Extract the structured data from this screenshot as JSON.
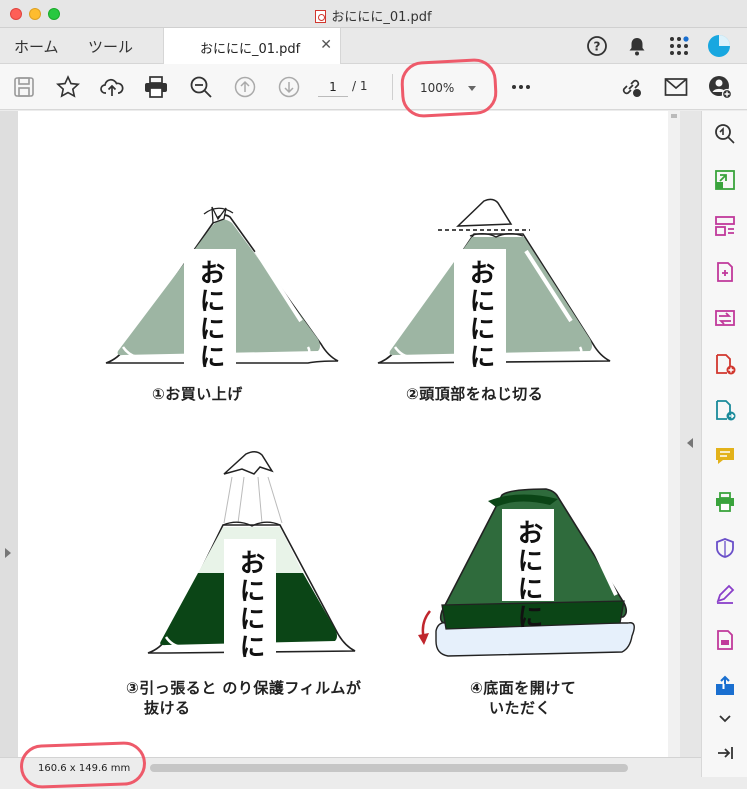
{
  "window": {
    "title": "おににに_01.pdf"
  },
  "tabs": {
    "home": "ホーム",
    "tools": "ツール",
    "document": "おににに_01.pdf"
  },
  "toolbar": {
    "page_current": "1",
    "page_total": "/ 1",
    "zoom": "100%"
  },
  "document": {
    "onigiri_label": "おににに",
    "steps": [
      {
        "caption": "①お買い上げ"
      },
      {
        "caption": "②頭頂部をねじ切る"
      },
      {
        "caption_line1": "③引っ張ると のり保護フィルムが",
        "caption_line2": "抜ける"
      },
      {
        "caption_line1": "④底面を開けて",
        "caption_line2": "いただく"
      }
    ]
  },
  "status": {
    "page_size": "160.6 x 149.6 mm"
  },
  "colors": {
    "light_nori": "#9db5a3",
    "dark_nori": "#0b4516",
    "mid_nori": "#2f6b3c",
    "annotation": "#ee5a6a",
    "accent_magenta": "#c0399b",
    "accent_green": "#3aa33c",
    "accent_yellow": "#e3b21a",
    "accent_blue": "#1a6fd0"
  }
}
